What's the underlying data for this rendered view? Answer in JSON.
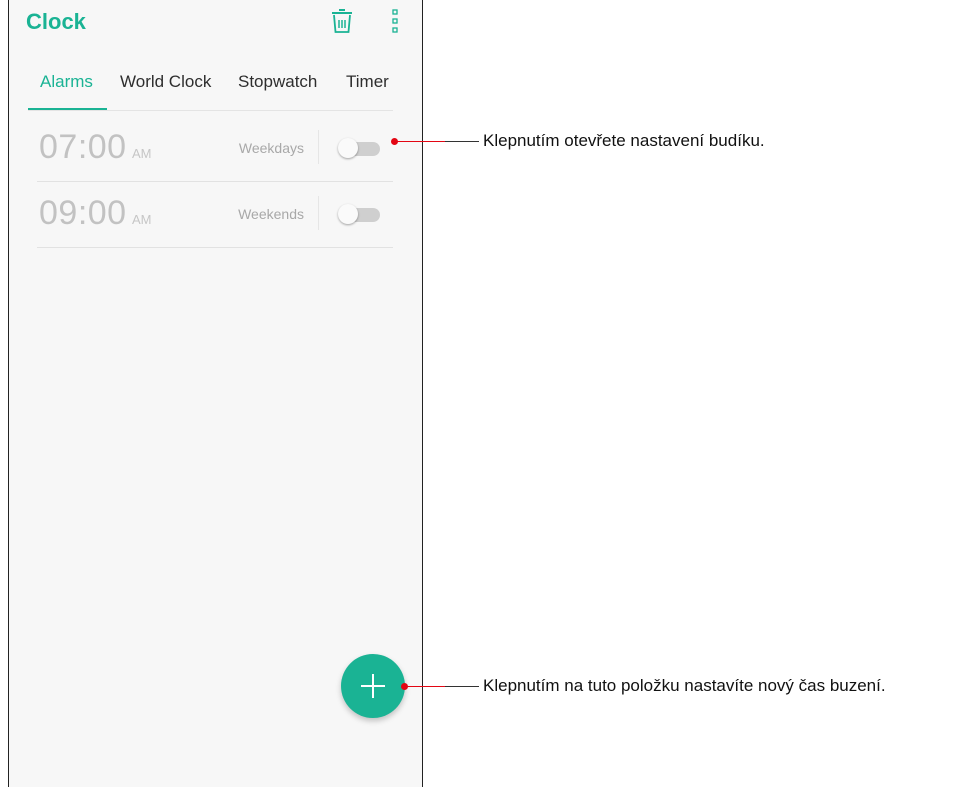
{
  "app": {
    "title": "Clock"
  },
  "toolbar": {
    "delete_icon": "trash-icon",
    "more_icon": "more-vert-icon"
  },
  "tabs": [
    {
      "label": "Alarms",
      "active": true
    },
    {
      "label": "World Clock",
      "active": false
    },
    {
      "label": "Stopwatch",
      "active": false
    },
    {
      "label": "Timer",
      "active": false
    }
  ],
  "alarms": [
    {
      "time": "07:00",
      "ampm": "AM",
      "repeat": "Weekdays",
      "enabled": false
    },
    {
      "time": "09:00",
      "ampm": "AM",
      "repeat": "Weekends",
      "enabled": false
    }
  ],
  "fab": {
    "icon": "plus-icon"
  },
  "callouts": {
    "alarm_settings": "Klepnutím otevřete nastavení budíku.",
    "add_alarm": "Klepnutím na tuto položku nastavíte nový čas buzení."
  },
  "colors": {
    "accent": "#1ab394",
    "callout": "#e30613"
  }
}
